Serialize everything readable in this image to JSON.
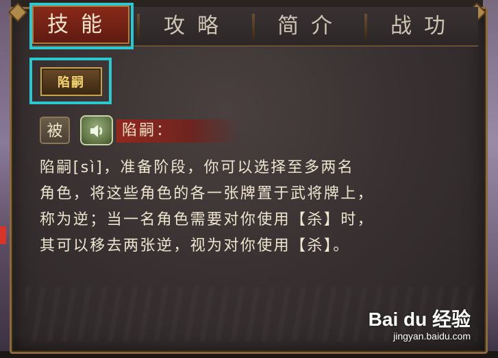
{
  "tabs": [
    {
      "label": "技能",
      "active": true
    },
    {
      "label": "攻略",
      "active": false
    },
    {
      "label": "简介",
      "active": false
    },
    {
      "label": "战功",
      "active": false
    }
  ],
  "skill_tabs": [
    {
      "label": "陷嗣",
      "active": true
    }
  ],
  "skill": {
    "type_badge": "被",
    "name_label": "陷嗣：",
    "description_lines": [
      "陷嗣[sì]，准备阶段，你可以选择至多两名",
      "角色，将这些角色的各一张牌置于武将牌上，",
      "称为逆；当一名角色需要对你使用【杀】时，",
      "其可以移去两张逆，视为对你使用【杀】。"
    ]
  },
  "watermark": {
    "logo": "Bai du 经验",
    "url": "jingyan.baidu.com"
  },
  "colors": {
    "highlight": "#2cc7d0",
    "active_tab": "#8a2a1a",
    "text": "#efe5d0",
    "gold": "#f5d670"
  },
  "icons": {
    "sound": "speaker-icon"
  }
}
